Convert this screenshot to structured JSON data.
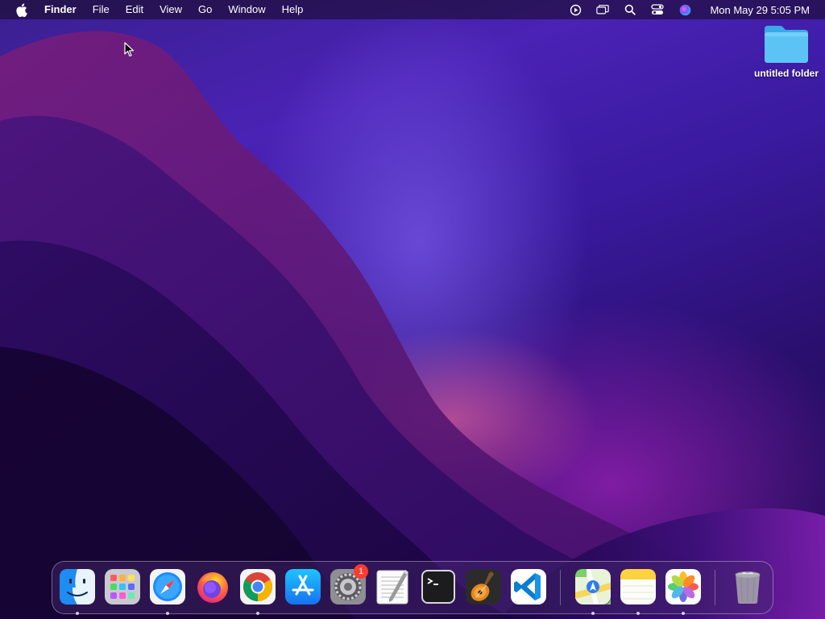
{
  "menubar": {
    "app_name": "Finder",
    "items": [
      "File",
      "Edit",
      "View",
      "Go",
      "Window",
      "Help"
    ],
    "clock": "Mon May 29  5:05 PM",
    "status_icons": [
      "screen-record-icon",
      "window-switch-icon",
      "spotlight-search-icon",
      "control-center-icon",
      "siri-icon"
    ]
  },
  "desktop": {
    "folder_label": "untitled folder"
  },
  "dock": {
    "apps": [
      {
        "name": "Finder",
        "icon": "finder-icon",
        "running": true
      },
      {
        "name": "Launchpad",
        "icon": "launchpad-icon",
        "running": false
      },
      {
        "name": "Safari",
        "icon": "safari-icon",
        "running": true
      },
      {
        "name": "Firefox",
        "icon": "firefox-icon",
        "running": false
      },
      {
        "name": "Google Chrome",
        "icon": "chrome-icon",
        "running": true
      },
      {
        "name": "App Store",
        "icon": "app-store-icon",
        "running": false
      },
      {
        "name": "System Settings",
        "icon": "system-settings-icon",
        "running": false,
        "badge": "1"
      },
      {
        "name": "TextEdit",
        "icon": "textedit-icon",
        "running": false
      },
      {
        "name": "Terminal",
        "icon": "terminal-icon",
        "running": false
      },
      {
        "name": "GarageBand",
        "icon": "garageband-icon",
        "running": false
      },
      {
        "name": "Visual Studio Code",
        "icon": "vscode-icon",
        "running": false
      },
      {
        "name": "Maps",
        "icon": "maps-icon",
        "running": true
      },
      {
        "name": "Notes",
        "icon": "notes-icon",
        "running": true
      },
      {
        "name": "Photos",
        "icon": "photos-icon",
        "running": true
      },
      {
        "name": "Trash",
        "icon": "trash-icon",
        "running": false
      }
    ]
  }
}
